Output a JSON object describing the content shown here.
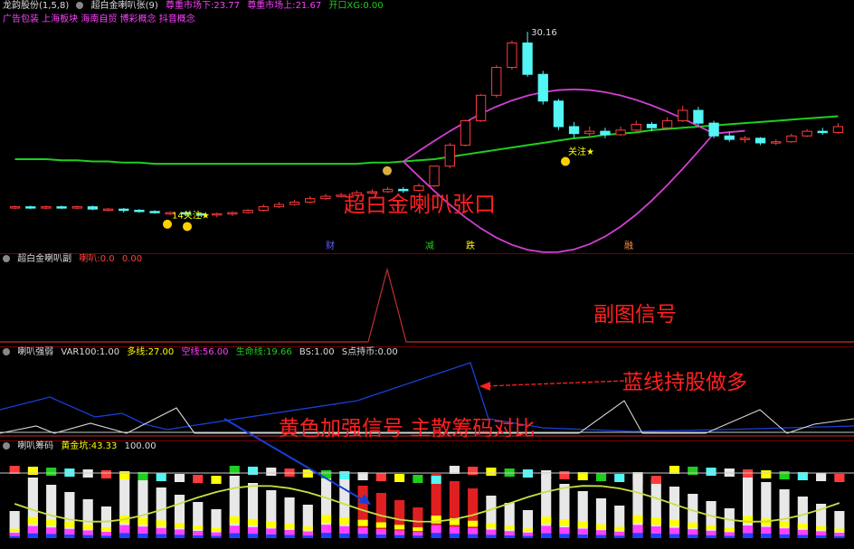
{
  "colors": {
    "up": "#ff3b3b",
    "down": "#53f5f5",
    "ma_green": "#1ecf1e",
    "band": "#d040d0",
    "yellow": "#ffff00",
    "magenta": "#ff40ff",
    "blue": "#1a3fd8",
    "white": "#e8e8e8",
    "dark_red": "#800000",
    "annotation": "#ff2020"
  },
  "main": {
    "header": {
      "name": "龙韵股份(1,5,8)",
      "indicator": "超白金喇叭张(9)",
      "val1_label": "尊重市场下:",
      "val1": "23.77",
      "val2_label": "尊重市场上:",
      "val2": "21.67",
      "val3_label": "开口XG:",
      "val3": "0.00"
    },
    "concepts": "广告包装 上海板块 海南自贸 博彩概念 抖音概念",
    "peak_label": "30.16",
    "tag_left": "14关注★",
    "tag_right": "关注★",
    "markers": [
      "财",
      "减",
      "跌",
      "融"
    ],
    "annotation": "超白金喇叭张口"
  },
  "sub1": {
    "header": {
      "name": "超白金喇叭副",
      "var": "喇叭:0.0",
      "val": "0.00"
    },
    "annotation": "副图信号"
  },
  "sub2": {
    "header": {
      "name": "喇叭强弱",
      "var": "VAR100:1.00",
      "l1": "多线:",
      "v1": "27.00",
      "l2": "空线:",
      "v2": "56.00",
      "l3": "生命线:",
      "v3": "19.66",
      "l4": "BS:",
      "v4": "1.00",
      "l5": "S点持币:",
      "v5": "0.00"
    },
    "annotation": "蓝线持股做多"
  },
  "sub3": {
    "header": {
      "name": "喇叭筹码",
      "l1": "黄金坑:",
      "v1": "43.33",
      "v2": "100.00"
    },
    "annotation": "黄色加强信号 主散筹码对比"
  },
  "chart_data": {
    "type": "candlestick",
    "title": "超白金喇叭张",
    "peak_high": 30.16,
    "candles": [
      {
        "o": 15.0,
        "c": 15.1,
        "h": 15.2,
        "l": 14.9
      },
      {
        "o": 15.1,
        "c": 15.0,
        "h": 15.2,
        "l": 14.9
      },
      {
        "o": 15.0,
        "c": 15.1,
        "h": 15.2,
        "l": 14.9
      },
      {
        "o": 15.1,
        "c": 15.0,
        "h": 15.2,
        "l": 14.9
      },
      {
        "o": 15.0,
        "c": 15.1,
        "h": 15.2,
        "l": 14.9
      },
      {
        "o": 15.1,
        "c": 14.9,
        "h": 15.2,
        "l": 14.8
      },
      {
        "o": 14.9,
        "c": 14.9,
        "h": 15.0,
        "l": 14.7
      },
      {
        "o": 14.9,
        "c": 14.8,
        "h": 15.0,
        "l": 14.6
      },
      {
        "o": 14.8,
        "c": 14.7,
        "h": 14.9,
        "l": 14.6
      },
      {
        "o": 14.7,
        "c": 14.6,
        "h": 14.8,
        "l": 14.5
      },
      {
        "o": 14.6,
        "c": 14.6,
        "h": 14.7,
        "l": 14.4
      },
      {
        "o": 14.6,
        "c": 14.5,
        "h": 14.7,
        "l": 14.3
      },
      {
        "o": 14.5,
        "c": 14.4,
        "h": 14.6,
        "l": 14.2
      },
      {
        "o": 14.4,
        "c": 14.5,
        "h": 14.6,
        "l": 14.2
      },
      {
        "o": 14.5,
        "c": 14.6,
        "h": 14.7,
        "l": 14.3
      },
      {
        "o": 14.6,
        "c": 14.8,
        "h": 14.9,
        "l": 14.5
      },
      {
        "o": 14.8,
        "c": 15.1,
        "h": 15.3,
        "l": 14.7
      },
      {
        "o": 15.1,
        "c": 15.3,
        "h": 15.5,
        "l": 15.0
      },
      {
        "o": 15.3,
        "c": 15.5,
        "h": 15.7,
        "l": 15.2
      },
      {
        "o": 15.5,
        "c": 15.8,
        "h": 16.0,
        "l": 15.4
      },
      {
        "o": 15.8,
        "c": 16.0,
        "h": 16.2,
        "l": 15.7
      },
      {
        "o": 16.0,
        "c": 16.1,
        "h": 16.3,
        "l": 15.9
      },
      {
        "o": 16.1,
        "c": 16.3,
        "h": 16.5,
        "l": 16.0
      },
      {
        "o": 16.3,
        "c": 16.4,
        "h": 16.6,
        "l": 16.2
      },
      {
        "o": 16.4,
        "c": 16.6,
        "h": 16.8,
        "l": 16.3
      },
      {
        "o": 16.6,
        "c": 16.5,
        "h": 16.8,
        "l": 16.3
      },
      {
        "o": 16.5,
        "c": 16.9,
        "h": 17.1,
        "l": 16.4
      },
      {
        "o": 16.9,
        "c": 18.6,
        "h": 18.6,
        "l": 16.8
      },
      {
        "o": 18.6,
        "c": 20.4,
        "h": 20.6,
        "l": 18.4
      },
      {
        "o": 20.4,
        "c": 22.5,
        "h": 22.6,
        "l": 20.3
      },
      {
        "o": 22.5,
        "c": 24.7,
        "h": 24.8,
        "l": 22.4
      },
      {
        "o": 24.7,
        "c": 27.1,
        "h": 27.3,
        "l": 24.5
      },
      {
        "o": 27.1,
        "c": 29.2,
        "h": 29.4,
        "l": 26.9
      },
      {
        "o": 29.2,
        "c": 26.5,
        "h": 30.16,
        "l": 26.3
      },
      {
        "o": 26.5,
        "c": 24.2,
        "h": 26.8,
        "l": 23.9
      },
      {
        "o": 24.2,
        "c": 22.0,
        "h": 24.4,
        "l": 21.7
      },
      {
        "o": 22.0,
        "c": 21.4,
        "h": 22.4,
        "l": 21.0
      },
      {
        "o": 21.4,
        "c": 21.6,
        "h": 22.0,
        "l": 21.1
      },
      {
        "o": 21.6,
        "c": 21.3,
        "h": 21.9,
        "l": 21.0
      },
      {
        "o": 21.3,
        "c": 21.7,
        "h": 22.0,
        "l": 21.2
      },
      {
        "o": 21.7,
        "c": 22.2,
        "h": 22.5,
        "l": 21.6
      },
      {
        "o": 22.2,
        "c": 21.9,
        "h": 22.4,
        "l": 21.6
      },
      {
        "o": 21.9,
        "c": 22.5,
        "h": 22.8,
        "l": 21.8
      },
      {
        "o": 22.5,
        "c": 23.4,
        "h": 23.8,
        "l": 22.4
      },
      {
        "o": 23.4,
        "c": 22.3,
        "h": 23.7,
        "l": 22.1
      },
      {
        "o": 22.3,
        "c": 21.2,
        "h": 22.5,
        "l": 21.0
      },
      {
        "o": 21.2,
        "c": 20.9,
        "h": 21.5,
        "l": 20.7
      },
      {
        "o": 20.9,
        "c": 21.0,
        "h": 21.2,
        "l": 20.6
      },
      {
        "o": 21.0,
        "c": 20.6,
        "h": 21.1,
        "l": 20.4
      },
      {
        "o": 20.6,
        "c": 20.7,
        "h": 20.9,
        "l": 20.4
      },
      {
        "o": 20.7,
        "c": 21.2,
        "h": 21.4,
        "l": 20.6
      },
      {
        "o": 21.2,
        "c": 21.6,
        "h": 21.8,
        "l": 21.1
      },
      {
        "o": 21.6,
        "c": 21.5,
        "h": 21.9,
        "l": 21.3
      },
      {
        "o": 21.5,
        "c": 22.0,
        "h": 22.3,
        "l": 21.4
      }
    ],
    "ma_green": [
      19.2,
      19.2,
      19.2,
      19.1,
      19.1,
      19.0,
      19.0,
      18.9,
      18.9,
      18.8,
      18.8,
      18.8,
      18.8,
      18.8,
      18.8,
      18.8,
      18.8,
      18.8,
      18.8,
      18.8,
      18.8,
      18.8,
      18.8,
      18.9,
      18.9,
      19.0,
      19.1,
      19.2,
      19.4,
      19.6,
      19.8,
      20.0,
      20.2,
      20.4,
      20.6,
      20.8,
      21.0,
      21.1,
      21.3,
      21.4,
      21.5,
      21.7,
      21.8,
      21.9,
      22.0,
      22.1,
      22.2,
      22.3,
      22.4,
      22.5,
      22.6,
      22.7,
      22.8,
      22.9
    ]
  }
}
